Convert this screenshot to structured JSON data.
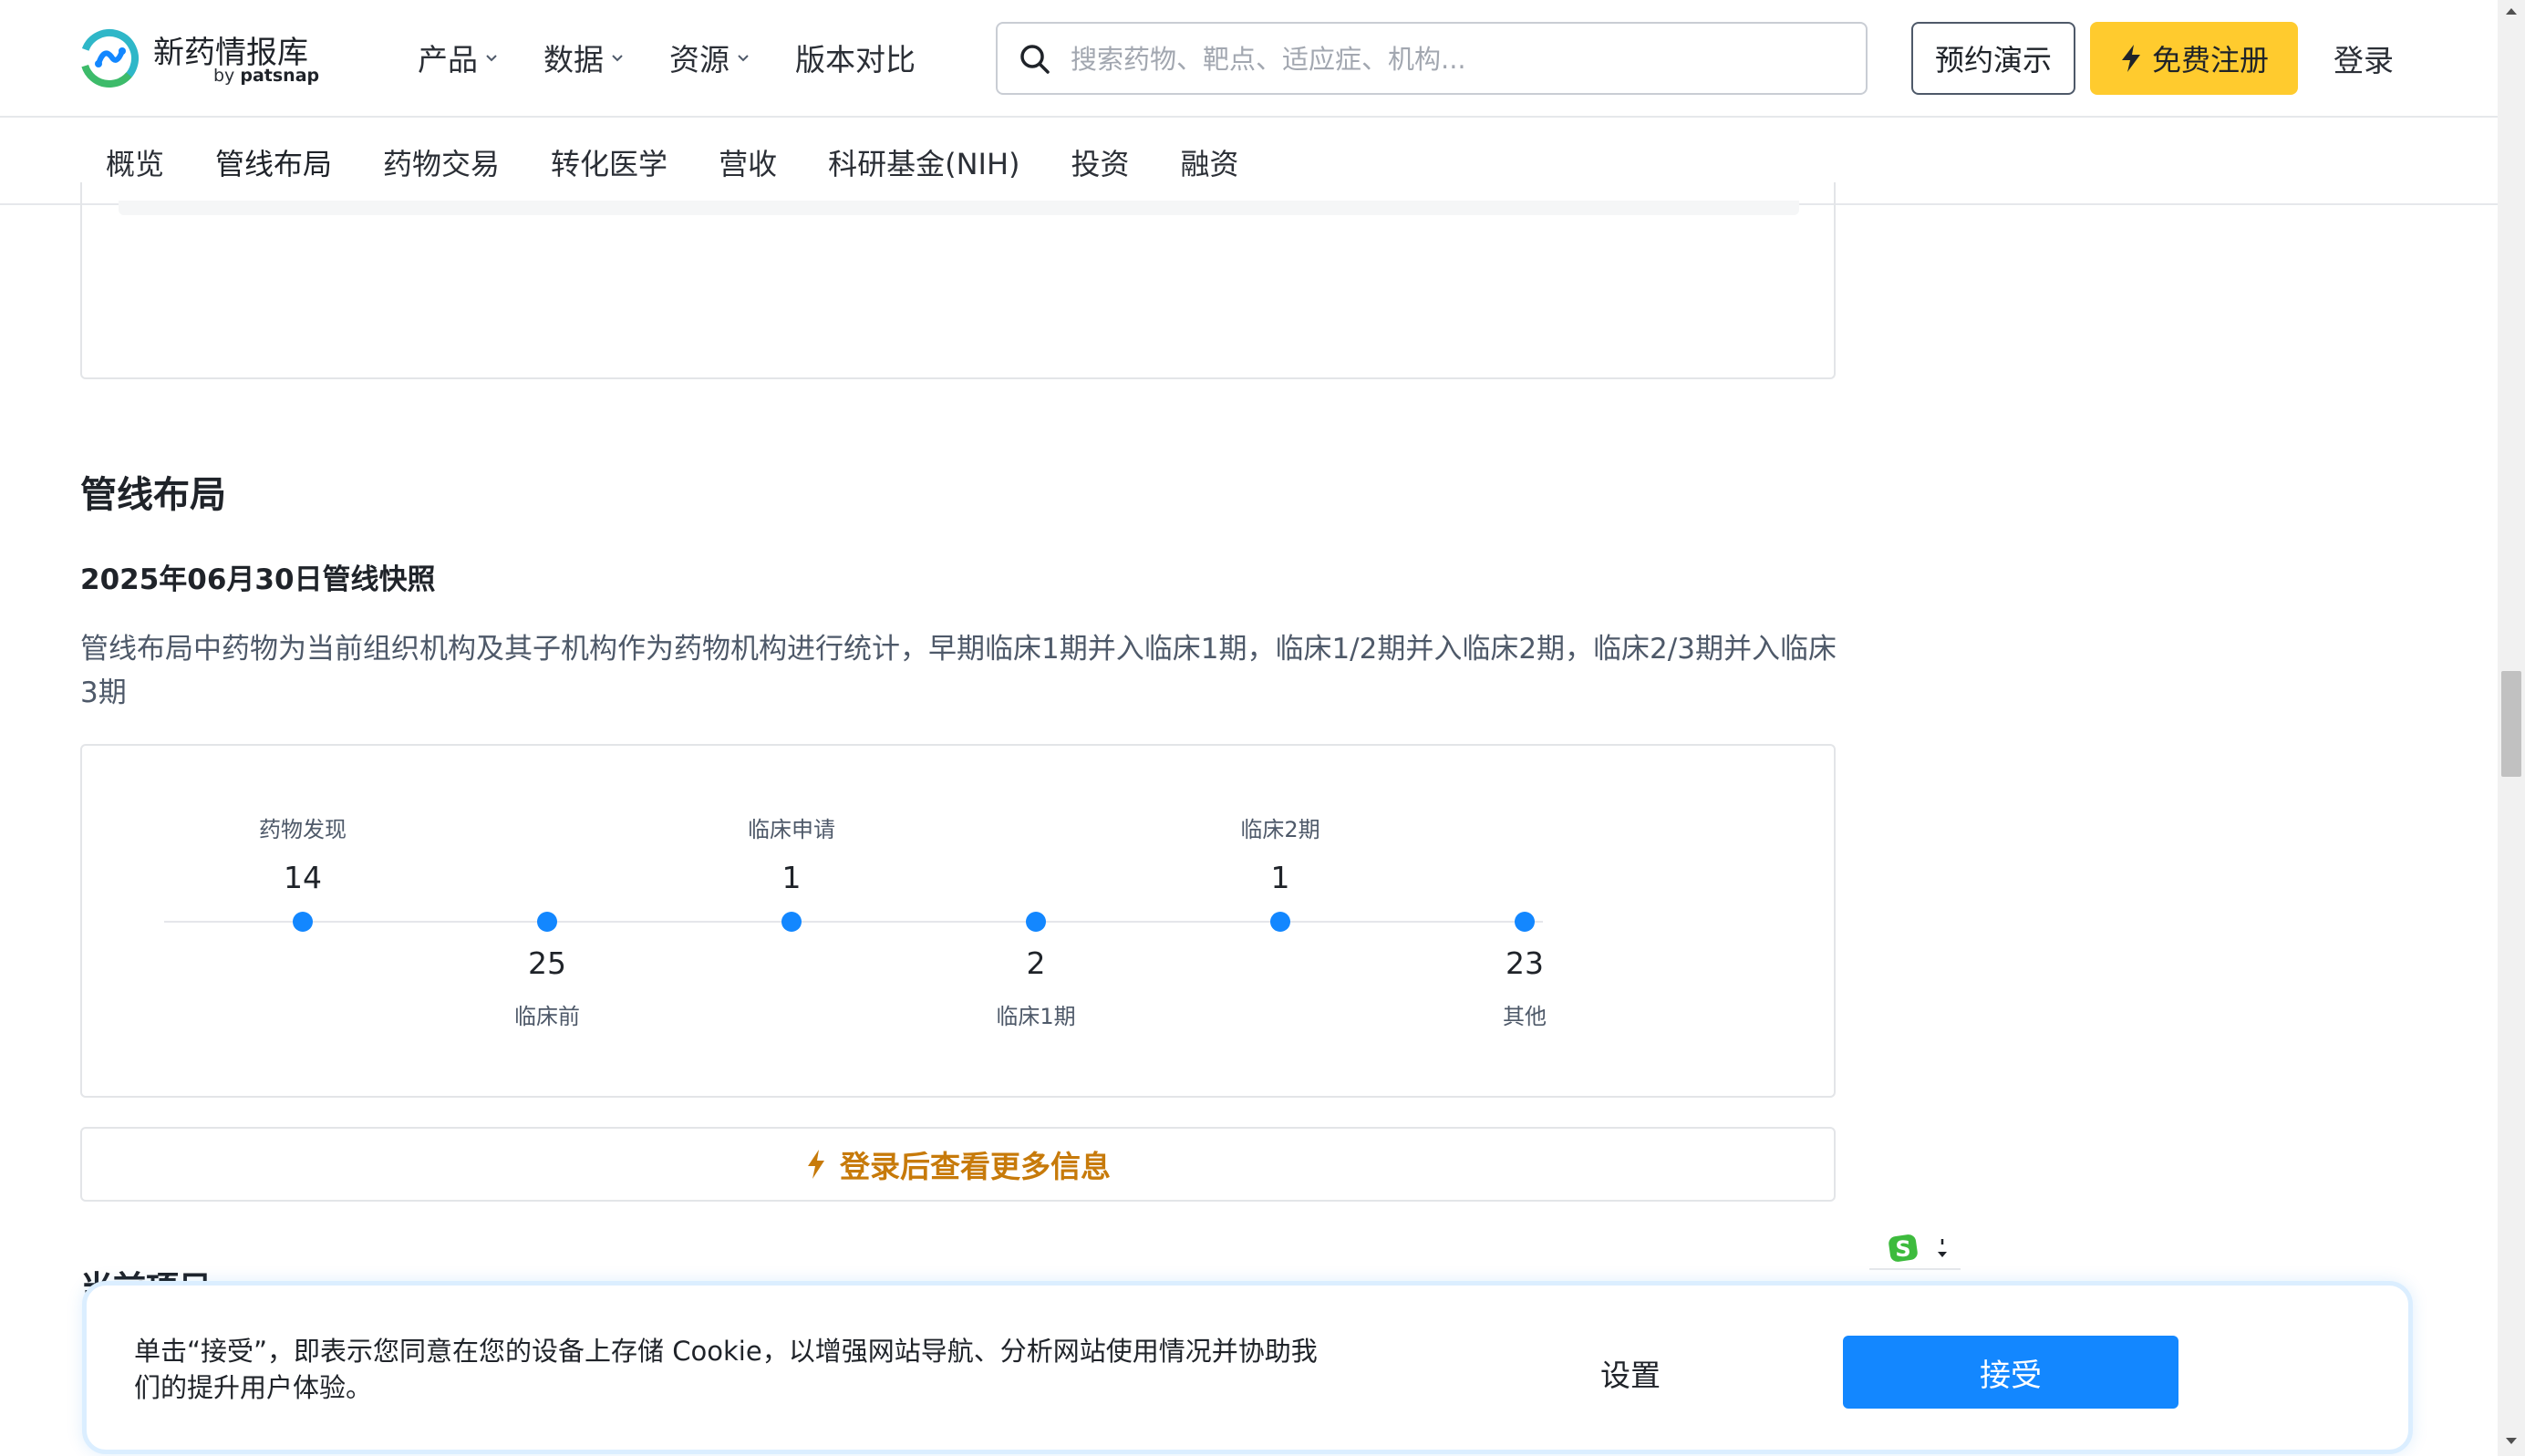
{
  "header": {
    "logo_text": "新药情报库",
    "logo_by": "by",
    "logo_brand": "patsnap",
    "nav": [
      {
        "label": "产品",
        "has_dropdown": true
      },
      {
        "label": "数据",
        "has_dropdown": true
      },
      {
        "label": "资源",
        "has_dropdown": true
      },
      {
        "label": "版本对比",
        "has_dropdown": false
      }
    ],
    "search_placeholder": "搜索药物、靶点、适应症、机构...",
    "search_value": "",
    "demo_button": "预约演示",
    "register_button": "免费注册",
    "login_link": "登录"
  },
  "tabs": {
    "items": [
      "概览",
      "管线布局",
      "药物交易",
      "转化医学",
      "营收",
      "科研基金(NIH)",
      "投资",
      "融资"
    ],
    "active": "管线布局"
  },
  "main": {
    "section_title": "管线布局",
    "snapshot_title": "2025年06月30日管线快照",
    "description": "管线布局中药物为当前组织机构及其子机构作为药物机构进行统计，早期临床1期并入临床1期，临床1/2期并入临床2期，临床2/3期并入临床3期",
    "login_more": "登录后查看更多信息",
    "partial_heading": "当前项目"
  },
  "pipeline": {
    "stages": [
      {
        "label": "药物发现",
        "count": "14",
        "position": "top"
      },
      {
        "label": "临床前",
        "count": "25",
        "position": "bottom"
      },
      {
        "label": "临床申请",
        "count": "1",
        "position": "top"
      },
      {
        "label": "临床1期",
        "count": "2",
        "position": "bottom"
      },
      {
        "label": "临床2期",
        "count": "1",
        "position": "top"
      },
      {
        "label": "其他",
        "count": "23",
        "position": "bottom"
      }
    ],
    "dot_color": "#1387ff",
    "line_color": "#e5e6eb"
  },
  "cookie": {
    "text": "单击“接受”，即表示您同意在您的设备上存储 Cookie，以增强网站导航、分析网站使用情况并协助我们的提升用户体验。",
    "settings_button": "设置",
    "accept_button": "接受"
  },
  "colors": {
    "accent_blue": "#1387ff",
    "register_yellow": "#ffcb2e",
    "login_more_orange": "#c77a0a"
  }
}
